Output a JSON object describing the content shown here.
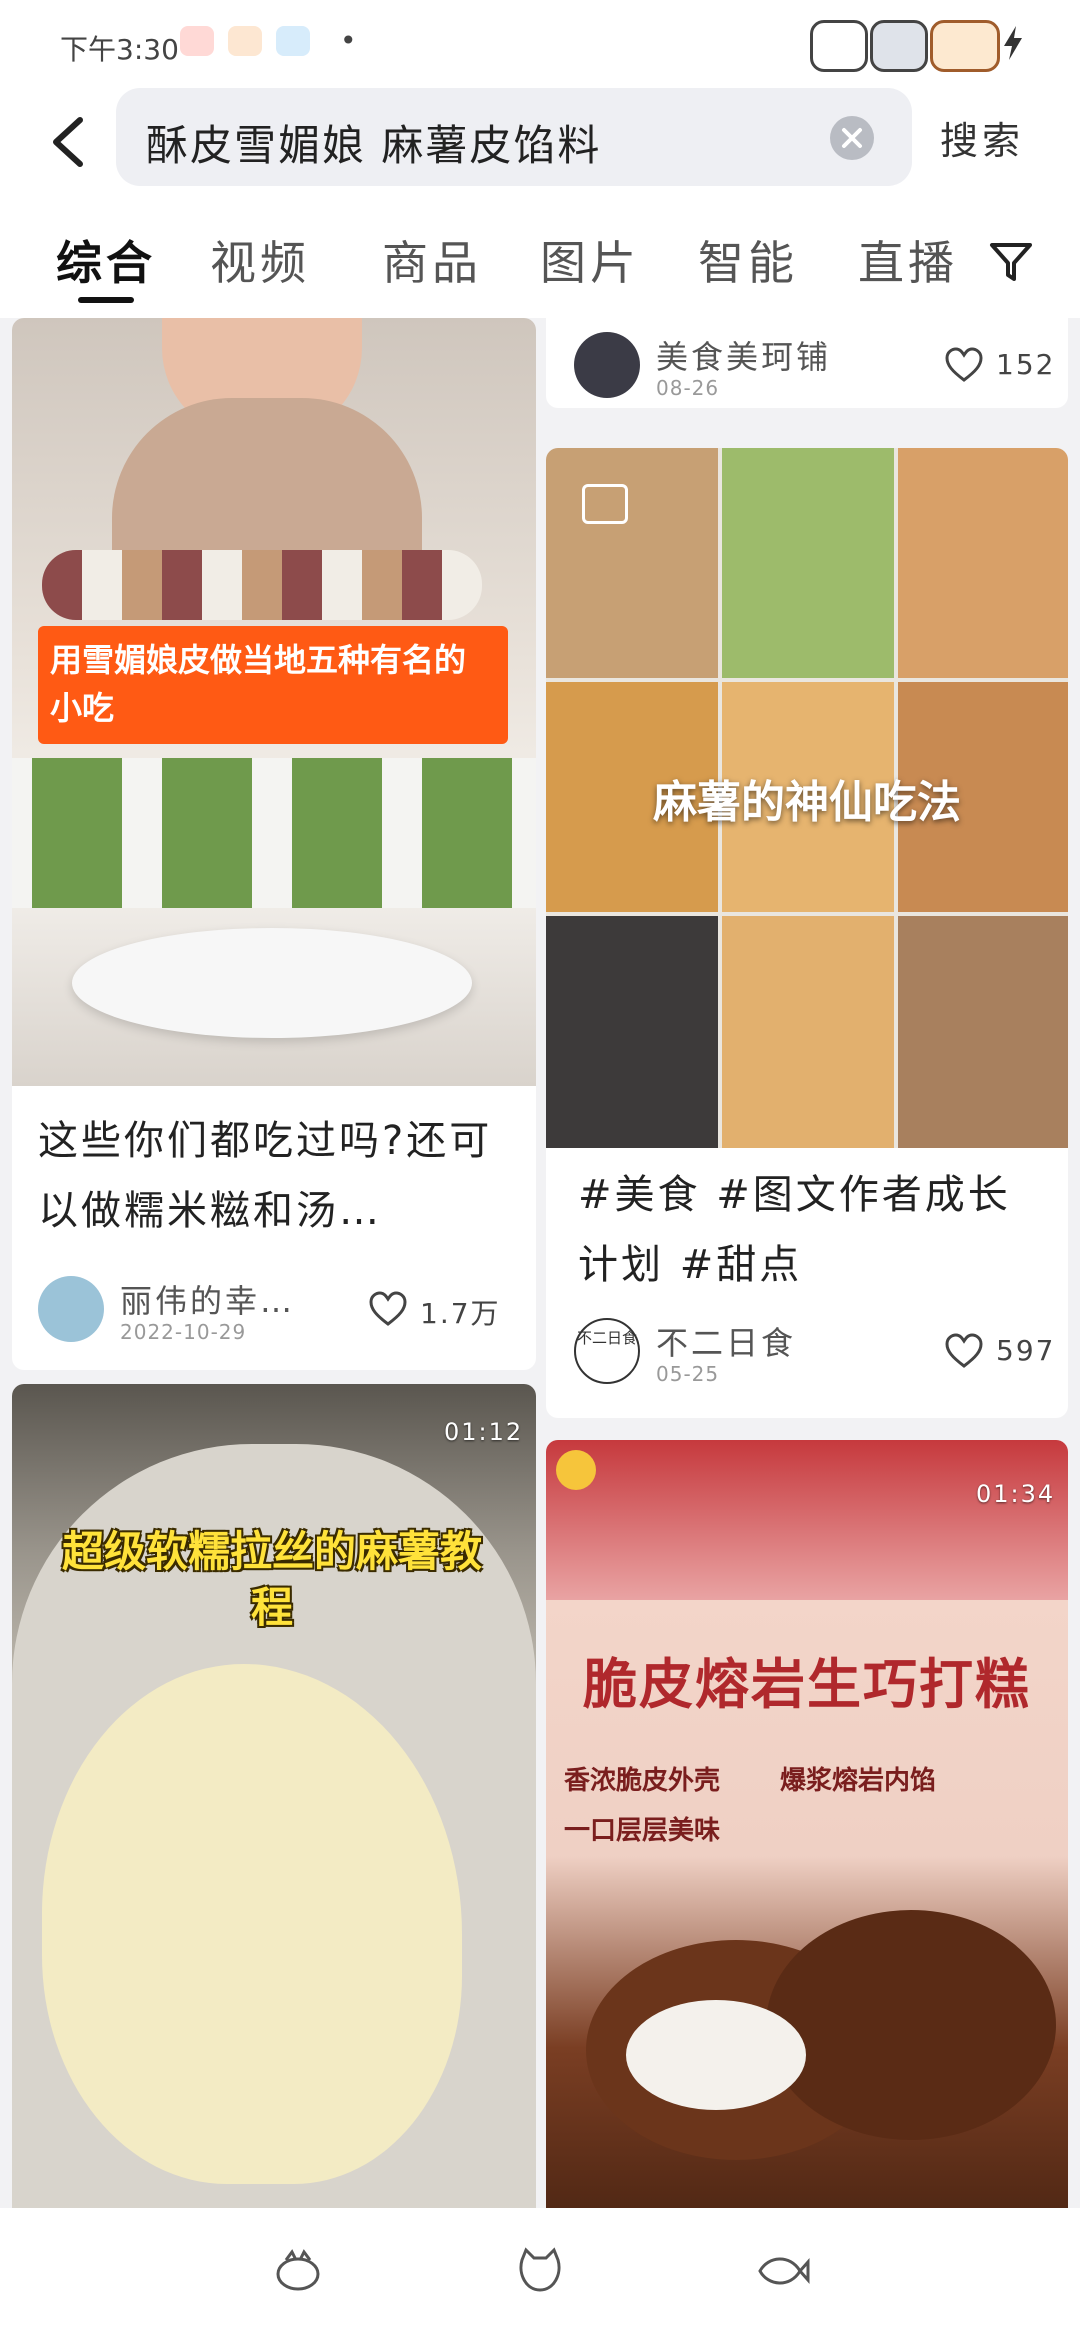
{
  "status_bar": {
    "time": "下午3:30",
    "dot": "•"
  },
  "search": {
    "query": "酥皮雪媚娘 麻薯皮馅料",
    "submit_label": "搜索"
  },
  "tabs": [
    {
      "label": "综合",
      "active": true
    },
    {
      "label": "视频",
      "active": false
    },
    {
      "label": "商品",
      "active": false
    },
    {
      "label": "图片",
      "active": false
    },
    {
      "label": "智能",
      "active": false
    },
    {
      "label": "直播",
      "active": false
    }
  ],
  "feed": {
    "left": [
      {
        "overlay_title": "用雪媚娘皮做当地五种有名的小吃",
        "caption": "这些你们都吃过吗?还可以做糯米糍和汤…",
        "author": "丽伟的幸…",
        "date": "2022-10-29",
        "likes": "1.7万"
      },
      {
        "overlay_title": "超级软糯拉丝的麻薯教程",
        "duration": "01:12"
      }
    ],
    "right": [
      {
        "author": "美食美珂铺",
        "date": "08-26",
        "likes": "152"
      },
      {
        "overlay_title": "麻薯的神仙吃法",
        "caption": "#美食 #图文作者成长计划 #甜点",
        "author": "不二日食",
        "avatar_text": "不二日食",
        "date": "05-25",
        "likes": "597"
      },
      {
        "banner_text": "脆皮熔岩生巧打糕",
        "tags": [
          "香浓脆皮外壳",
          "爆浆熔岩内馅",
          "一口层层美味"
        ],
        "duration": "01:34"
      }
    ]
  },
  "colors": {
    "accent_orange": "#ff5a14",
    "title_yellow": "#ffe23a",
    "like_gray": "#444444"
  },
  "icons": [
    "back-arrow-icon",
    "clear-icon",
    "filter-icon",
    "heart-icon",
    "nav-home-icon",
    "nav-cat-icon",
    "nav-fish-icon"
  ]
}
